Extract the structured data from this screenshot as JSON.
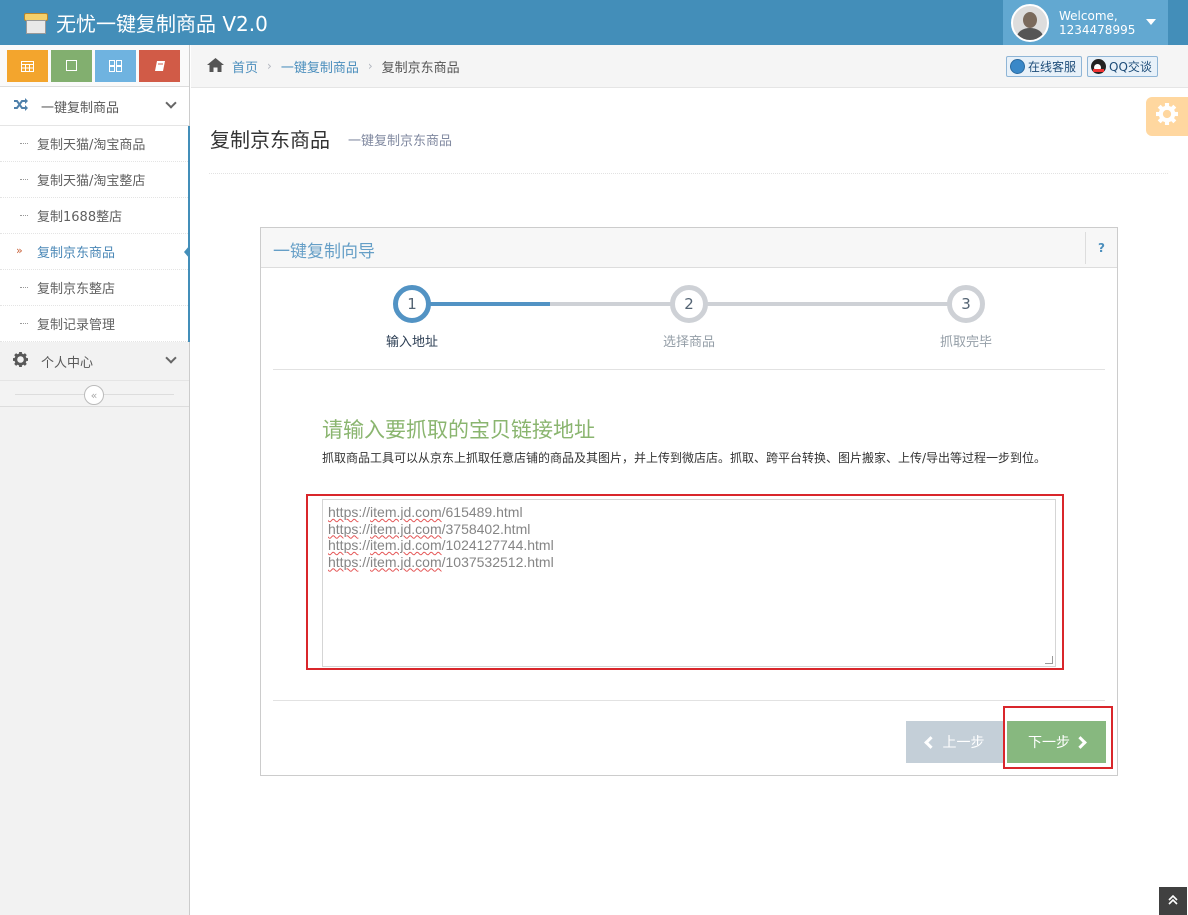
{
  "app": {
    "title": "无忧一键复制商品 V2.0"
  },
  "user": {
    "greeting": "Welcome,",
    "name": "1234478995"
  },
  "sidebar": {
    "groups": [
      {
        "label": "一键复制商品"
      },
      {
        "label": "个人中心"
      }
    ],
    "items": [
      {
        "label": "复制天猫/淘宝商品"
      },
      {
        "label": "复制天猫/淘宝整店"
      },
      {
        "label": "复制1688整店"
      },
      {
        "label": "复制京东商品"
      },
      {
        "label": "复制京东整店"
      },
      {
        "label": "复制记录管理"
      }
    ],
    "active_item": "复制京东商品"
  },
  "breadcrumbs": {
    "home": "首页",
    "parent": "一键复制商品",
    "current": "复制京东商品"
  },
  "service": {
    "online": "在线客服",
    "qq": "QQ交谈"
  },
  "page": {
    "title": "复制京东商品",
    "subtitle": "一键复制京东商品"
  },
  "wizard": {
    "title": "一键复制向导",
    "help": "?",
    "steps": [
      {
        "number": "1",
        "label": "输入地址",
        "state": "active"
      },
      {
        "number": "2",
        "label": "选择商品",
        "state": "pending"
      },
      {
        "number": "3",
        "label": "抓取完毕",
        "state": "pending"
      }
    ],
    "form_title": "请输入要抓取的宝贝链接地址",
    "form_desc": "抓取商品工具可以从京东上抓取任意店铺的商品及其图片，并上传到微店店。抓取、跨平台转换、图片搬家、上传/导出等过程一步到位。",
    "urls": [
      {
        "scheme": "https",
        "host": "item.jd.com",
        "path": "/615489.html"
      },
      {
        "scheme": "https",
        "host": "item.jd.com",
        "path": "/3758402.html"
      },
      {
        "scheme": "https",
        "host": "item.jd.com",
        "path": "/1024127744.html"
      },
      {
        "scheme": "https",
        "host": "item.jd.com",
        "path": "/1037532512.html"
      }
    ],
    "prev_label": "上一步",
    "next_label": "下一步"
  },
  "icons": {
    "brand": "box-icon",
    "home": "home-icon",
    "settings": "gear-icon",
    "group1": "random-icon",
    "group2": "cog-icon",
    "collapse": "double-angle-left-icon",
    "scroll_top": "double-angle-up-icon"
  },
  "colors": {
    "navbar": "#438eb9",
    "accent": "#5293c4",
    "success": "#87b87f",
    "highlight": "#d9262b"
  }
}
